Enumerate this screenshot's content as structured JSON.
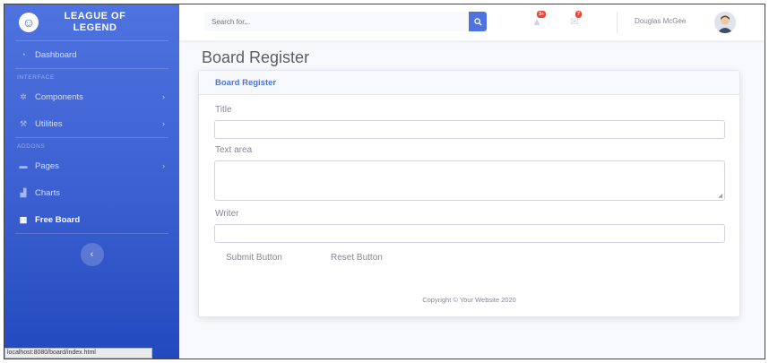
{
  "brand": {
    "title": "LEAGUE OF LEGEND",
    "logo_icon": "laughing-face-icon"
  },
  "sidebar": {
    "dashboard": {
      "label": "Dashboard",
      "icon": "tachometer-icon"
    },
    "heading_interface": "INTERFACE",
    "components": {
      "label": "Components",
      "icon": "gear-icon"
    },
    "utilities": {
      "label": "Utilities",
      "icon": "wrench-icon"
    },
    "heading_addons": "ADDONS",
    "pages": {
      "label": "Pages",
      "icon": "folder-icon"
    },
    "charts": {
      "label": "Charts",
      "icon": "chart-area-icon"
    },
    "free_board": {
      "label": "Free Board",
      "icon": "table-icon"
    },
    "toggle_icon": "chevron-left-icon"
  },
  "topbar": {
    "search_placeholder": "Search for...",
    "alerts_badge": "3+",
    "messages_badge": "7",
    "user_name": "Douglas McGee"
  },
  "page": {
    "title": "Board Register"
  },
  "card": {
    "header": "Board Register",
    "title_label": "Title",
    "title_value": "",
    "textarea_label": "Text area",
    "textarea_value": "",
    "writer_label": "Writer",
    "writer_value": "",
    "submit_label": "Submit Button",
    "reset_label": "Reset Button",
    "copyright": "Copyright © Your Website 2020"
  },
  "statusbar": {
    "url": "localhost:8080/board/index.html"
  },
  "colors": {
    "primary": "#4e73df",
    "sidebar_dark": "#224abe",
    "danger": "#e74a3b",
    "text_muted": "#858796"
  }
}
